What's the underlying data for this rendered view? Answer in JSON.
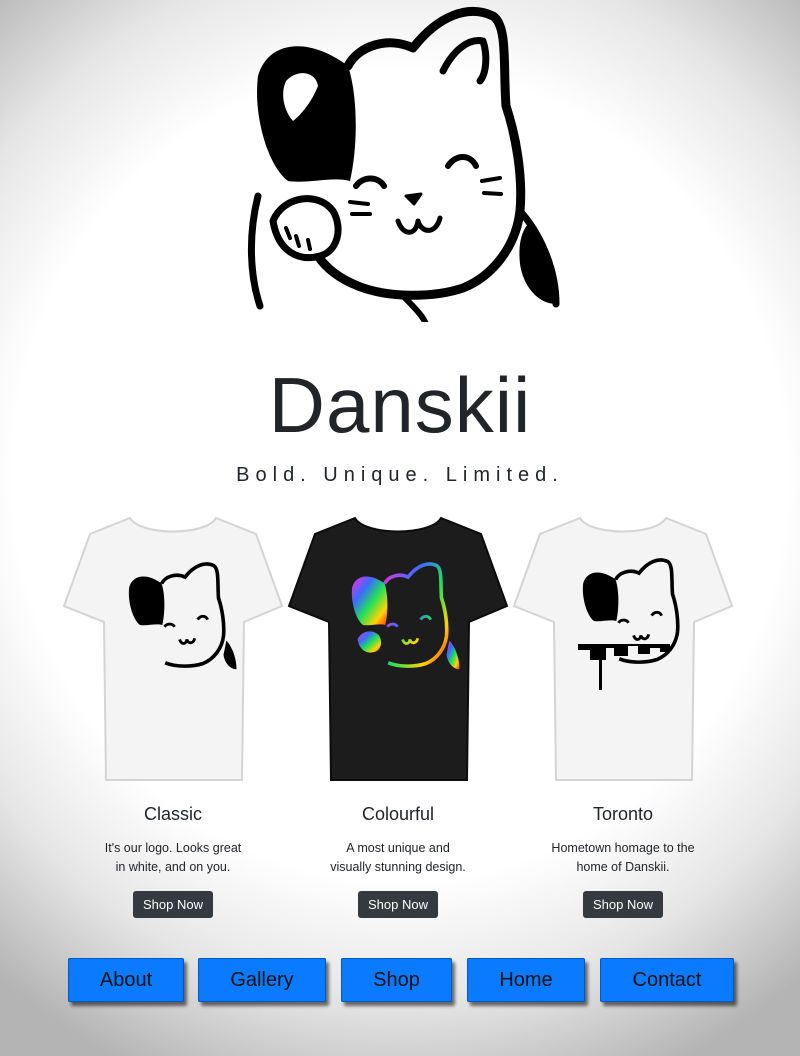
{
  "brand": {
    "name": "Danskii",
    "tagline": "Bold. Unique. Limited."
  },
  "products": [
    {
      "title": "Classic",
      "desc_line1": "It's our logo. Looks great",
      "desc_line2": "in white, and on you.",
      "button": "Shop Now",
      "shirt_color": "#f4f4f4"
    },
    {
      "title": "Colourful",
      "desc_line1": "A most unique and",
      "desc_line2": "visually stunning design.",
      "button": "Shop Now",
      "shirt_color": "#1c1c1c"
    },
    {
      "title": "Toronto",
      "desc_line1": "Hometown homage to the",
      "desc_line2": "home of Danskii.",
      "button": "Shop Now",
      "shirt_color": "#f4f4f4"
    }
  ],
  "nav": {
    "about": "About",
    "gallery": "Gallery",
    "shop": "Shop",
    "home": "Home",
    "contact": "Contact"
  },
  "colors": {
    "nav_button": "#0a7bff",
    "shop_button": "#343a40",
    "text": "#212529"
  }
}
